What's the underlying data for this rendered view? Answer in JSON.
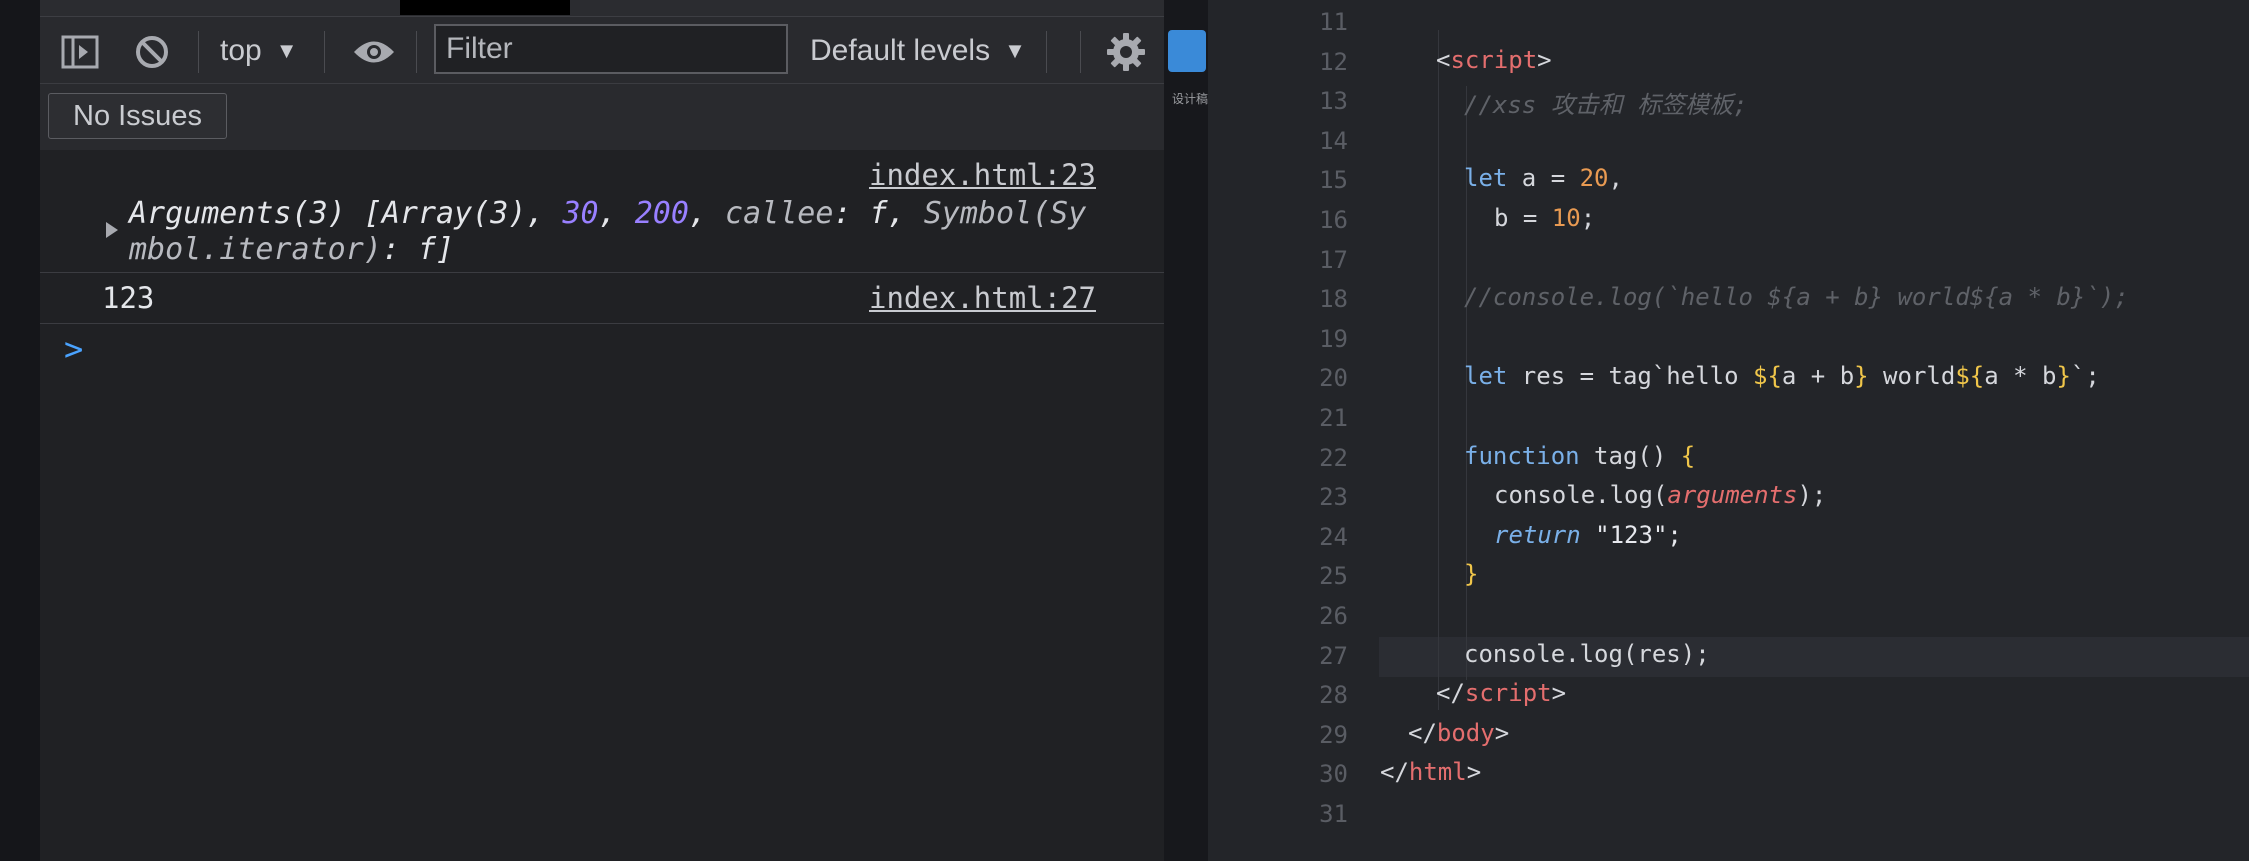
{
  "devtools": {
    "toolbar": {
      "sidebar_icon": "sidebar-toggle-icon",
      "clear_icon": "block-icon",
      "context": "top",
      "eye_icon": "eye-icon",
      "filter_placeholder": "Filter",
      "levels": "Default levels",
      "settings_icon": "gear-icon"
    },
    "issues_button": "No Issues",
    "messages": [
      {
        "source": "index.html:23",
        "prefix": "Arguments(3) [Array(3), ",
        "n1": "30",
        "sep1": ", ",
        "n2": "200",
        "sep2": ", ",
        "callee_key": "callee",
        "callee_val": ": f, ",
        "symbol_key": "Symbol(Sy",
        "line2_key": "mbol.iterator)",
        "line2_val": ": f]"
      },
      {
        "value": "123",
        "source": "index.html:27"
      }
    ],
    "prompt": ">"
  },
  "sidebar_strip": {
    "folder_label": "设计稿"
  },
  "editor": {
    "line_numbers": [
      "11",
      "12",
      "13",
      "14",
      "15",
      "16",
      "17",
      "18",
      "19",
      "20",
      "21",
      "22",
      "23",
      "24",
      "25",
      "26",
      "27",
      "28",
      "29",
      "30",
      "31"
    ],
    "lines": {
      "l12_open": "<",
      "l12_tag": "script",
      "l12_close": ">",
      "l13": "//xss 攻击和 标签模板;",
      "l15_kw": "let",
      "l15_a": " a = ",
      "l15_num": "20",
      "l15_end": ",",
      "l16_b": "b = ",
      "l16_num": "10",
      "l16_end": ";",
      "l18": "//console.log(`hello ${a + b} world${a * b}`);",
      "l20_kw": "let",
      "l20_res": " res = tag`hello ",
      "l20_o1": "${",
      "l20_e1": "a + b",
      "l20_c1": "}",
      "l20_world": " world",
      "l20_o2": "${",
      "l20_e2": "a * b",
      "l20_c2": "}",
      "l20_end": "`;",
      "l22_kw": "function",
      "l22_name": " tag() ",
      "l22_brace": "{",
      "l23_pre": "console.log(",
      "l23_arg": "arguments",
      "l23_end": ");",
      "l24_kw": "return",
      "l24_str": " \"123\";",
      "l25_brace": "}",
      "l27": "console.log(res);",
      "l28_open": "</",
      "l28_tag": "script",
      "l28_close": ">",
      "l29_open": "</",
      "l29_tag": "body",
      "l29_close": ">",
      "l30_open": "</",
      "l30_tag": "html",
      "l30_close": ">"
    }
  }
}
